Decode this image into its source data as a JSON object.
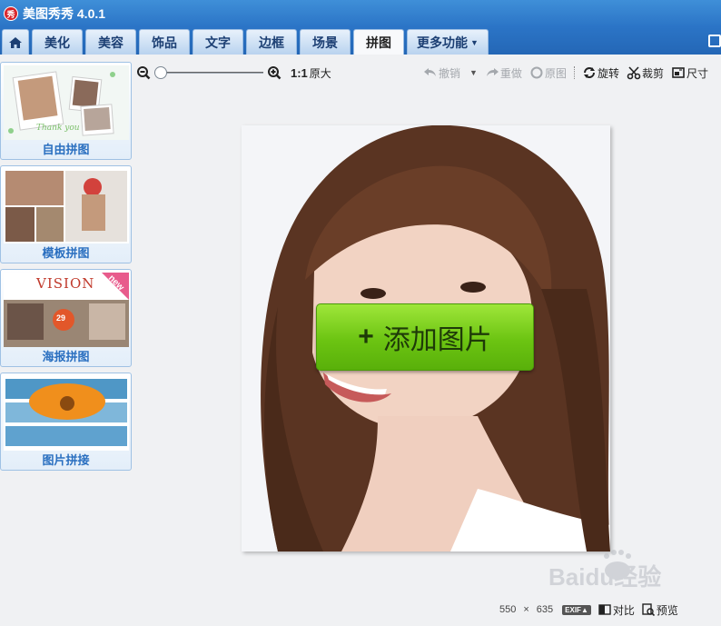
{
  "app": {
    "title": "美图秀秀 4.0.1",
    "logo_text": "秀"
  },
  "tabs": [
    {
      "id": "home",
      "label": ""
    },
    {
      "id": "beautify",
      "label": "美化"
    },
    {
      "id": "face",
      "label": "美容"
    },
    {
      "id": "decor",
      "label": "饰品"
    },
    {
      "id": "text",
      "label": "文字"
    },
    {
      "id": "frame",
      "label": "边框"
    },
    {
      "id": "scene",
      "label": "场景"
    },
    {
      "id": "collage",
      "label": "拼图",
      "active": true
    },
    {
      "id": "more",
      "label": "更多功能"
    }
  ],
  "sidebar": {
    "items": [
      {
        "label": "自由拼图",
        "thumb_text": "Thank you"
      },
      {
        "label": "模板拼图"
      },
      {
        "label": "海报拼图",
        "thumb_text": "VISION",
        "badge": "new",
        "number": "29"
      },
      {
        "label": "图片拼接"
      }
    ]
  },
  "toolbar": {
    "zoom_level": 0,
    "ratio": "1:1",
    "original_size": "原大",
    "undo": "撤销",
    "redo": "重做",
    "original": "原图",
    "rotate": "旋转",
    "crop": "裁剪",
    "size": "尺寸"
  },
  "canvas": {
    "add_button": "添加图片"
  },
  "status": {
    "width": "550",
    "times": "×",
    "height": "635",
    "exif": "EXIF▲",
    "compare": "对比",
    "preview": "预览"
  },
  "watermark": {
    "text": "Baidu经验"
  },
  "colors": {
    "titlebar": "#2b74c6",
    "accent_green": "#6cc412",
    "sidebar_label": "#2a6fc0"
  }
}
